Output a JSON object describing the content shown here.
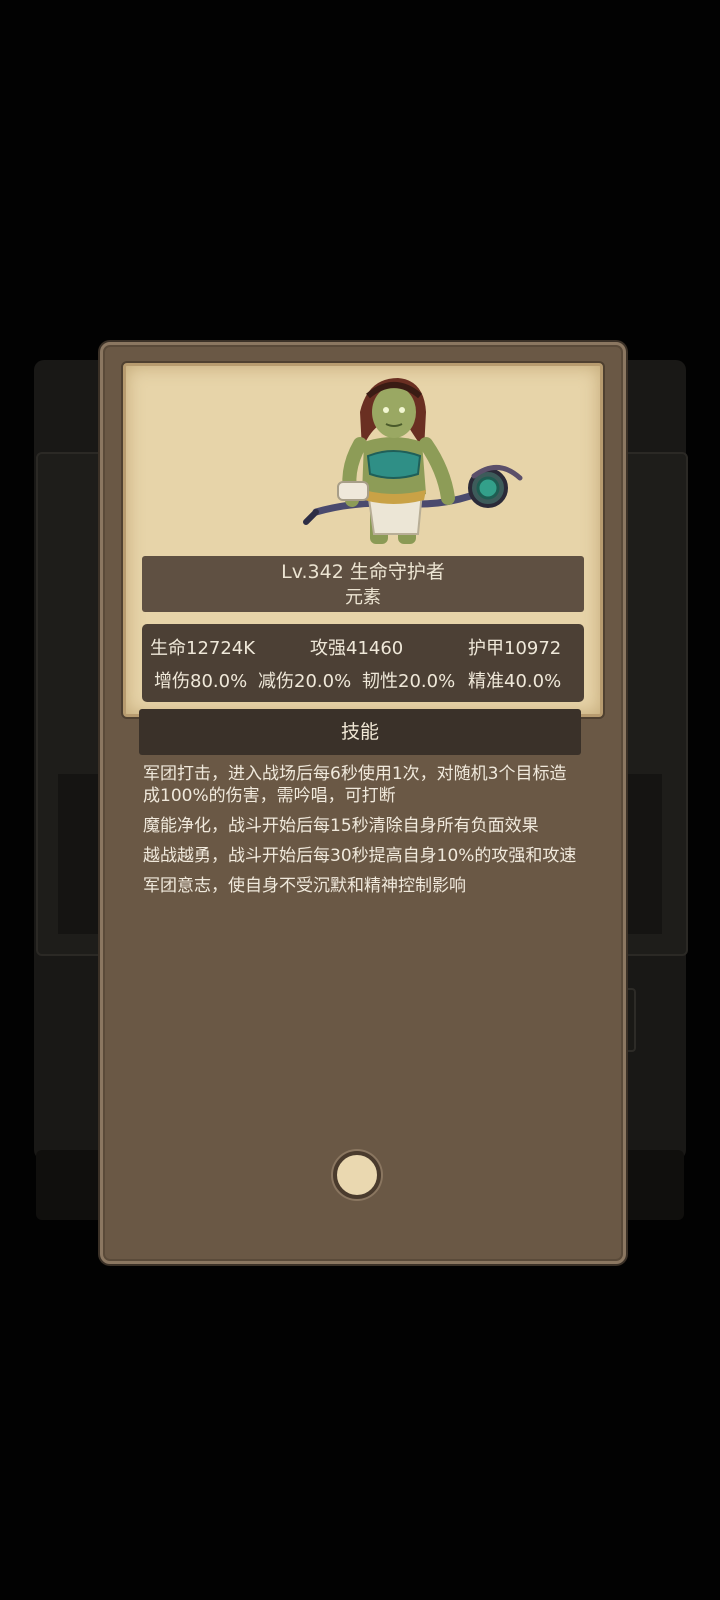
{
  "hero": {
    "level_name": "Lv.342 生命守护者",
    "element": "元素",
    "portrait_icon": "orc-shaman-staff-icon"
  },
  "stats": {
    "row1": [
      "生命12724K",
      "攻强41460",
      "护甲10972"
    ],
    "row2": [
      "增伤80.0%",
      "减伤20.0%",
      "韧性20.0%",
      "精准40.0%"
    ]
  },
  "skills": {
    "header": "技能",
    "items": [
      "军团打击，进入战场后每6秒使用1次，对随机3个目标造成100%的伤害，需吟唱，可打断",
      "魔能净化，战斗开始后每15秒清除自身所有负面效果",
      "越战越勇，战斗开始后每30秒提高自身10%的攻强和攻速",
      "军团意志，使自身不受沉默和精神控制影响"
    ]
  },
  "close_icon": "circle-close-icon",
  "colors": {
    "popup": "#6a5845",
    "parchment": "#e7d4a9",
    "text": "#efe8d9"
  }
}
